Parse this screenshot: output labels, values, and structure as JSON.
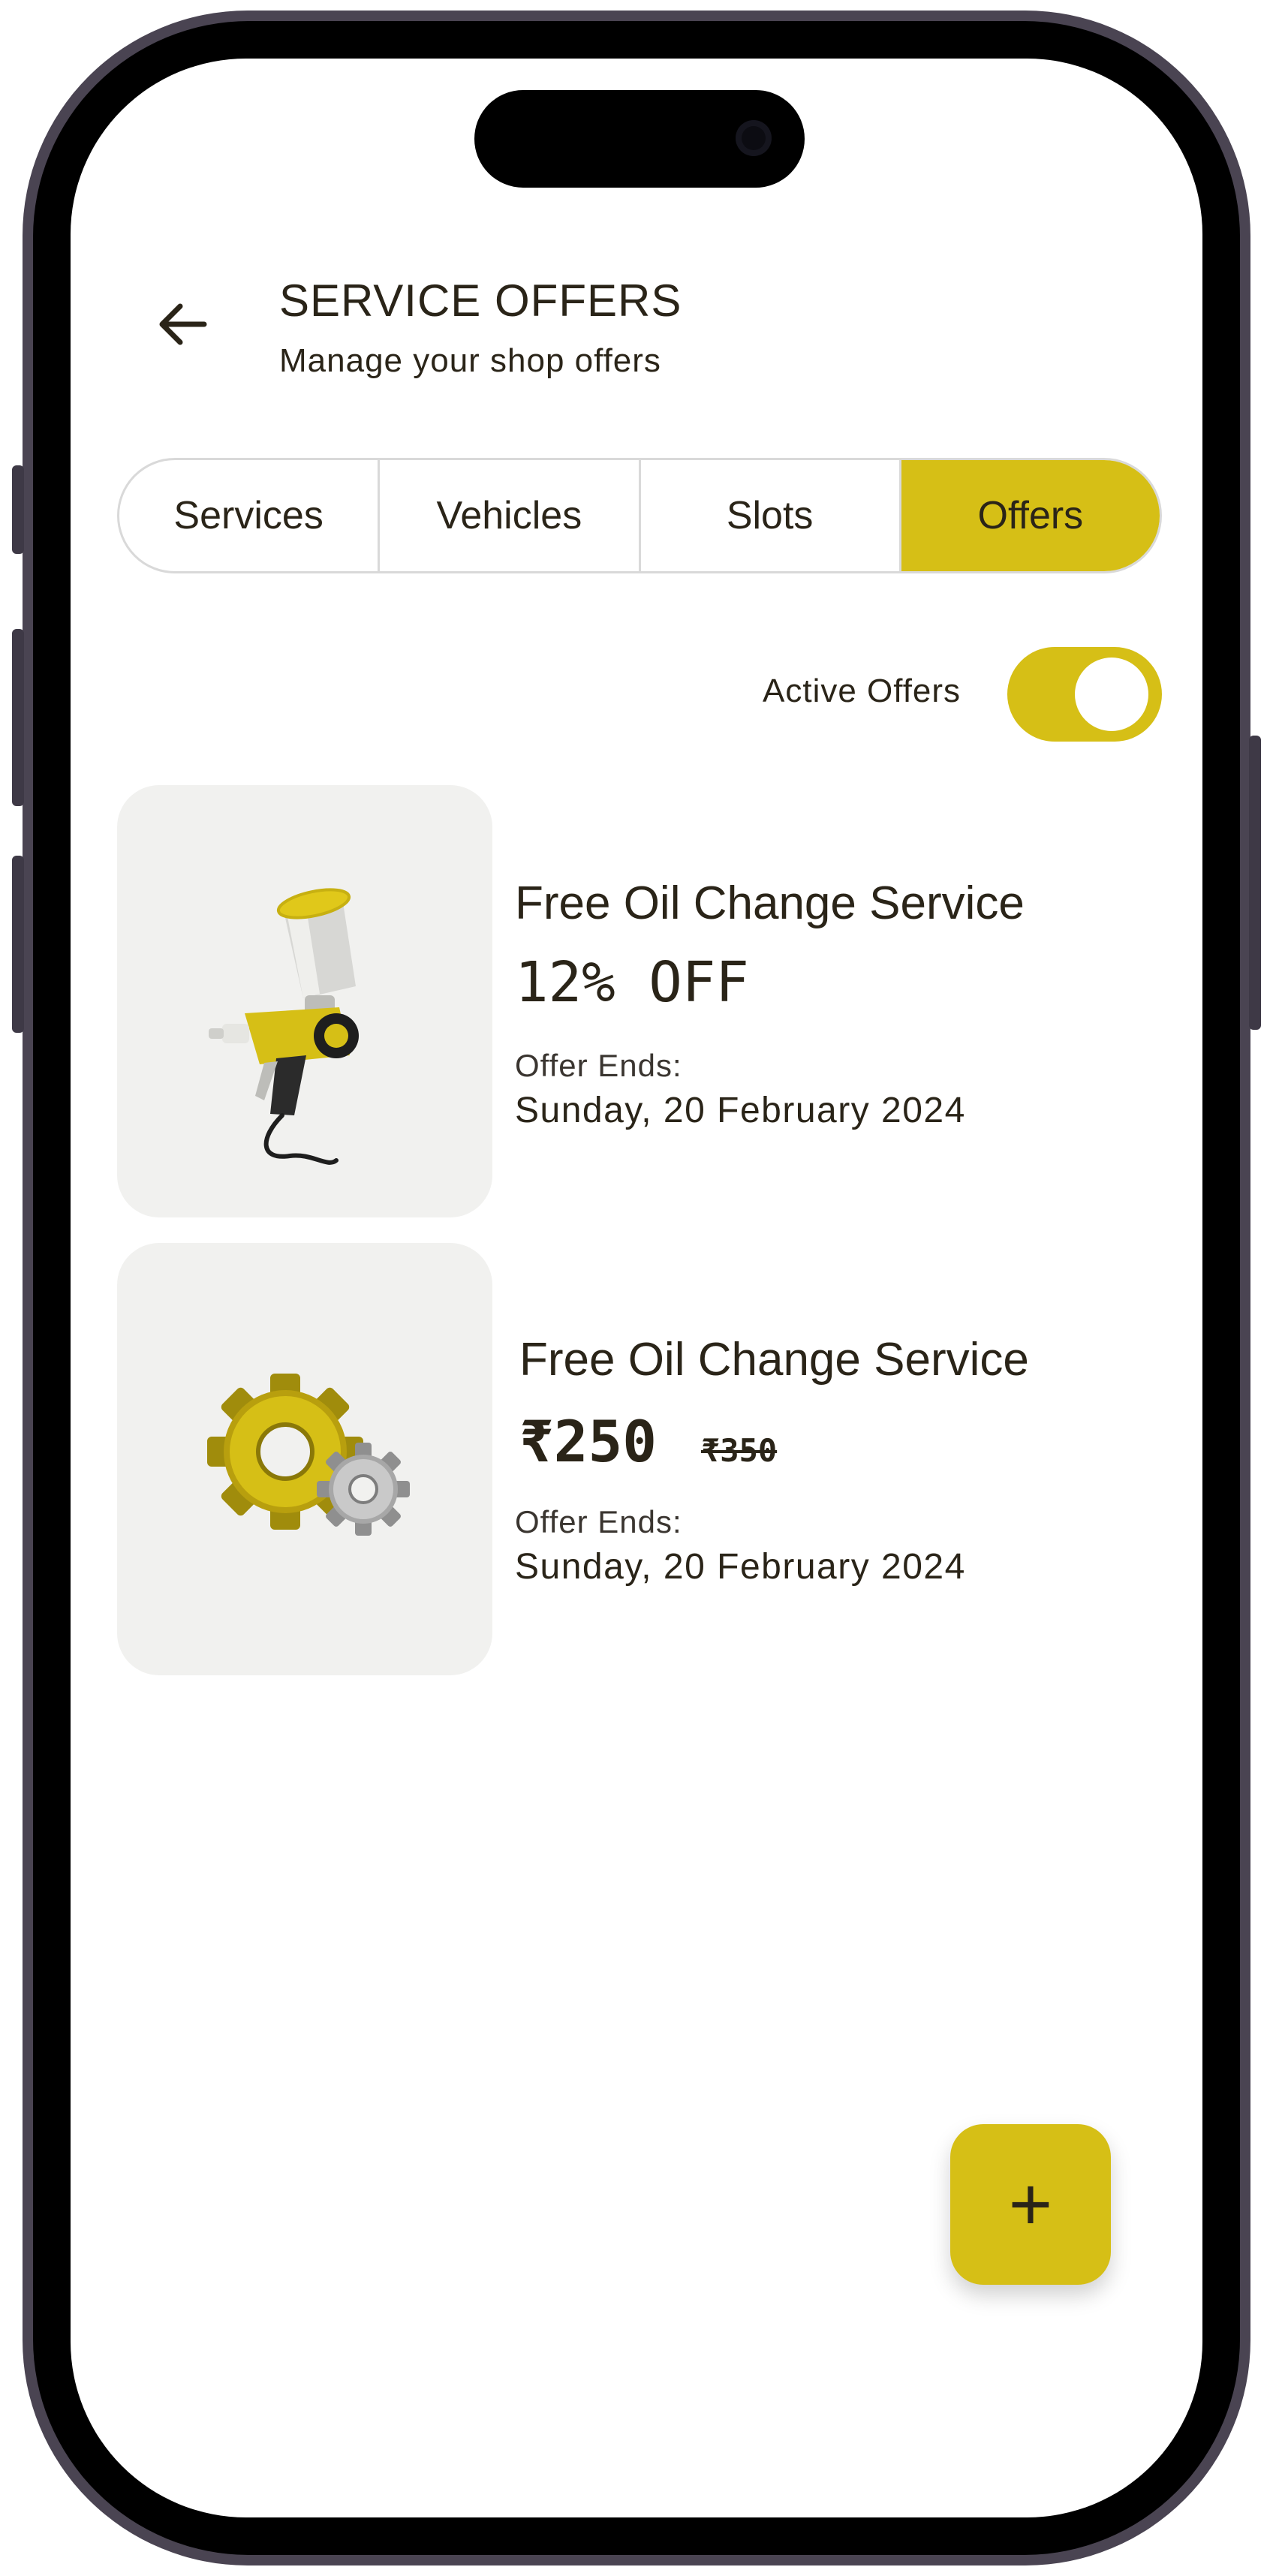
{
  "header": {
    "title": "SERVICE OFFERS",
    "subtitle": "Manage your shop offers",
    "back_icon": "arrow-left-icon"
  },
  "tabs": [
    {
      "label": "Services",
      "active": false
    },
    {
      "label": "Vehicles",
      "active": false
    },
    {
      "label": "Slots",
      "active": false
    },
    {
      "label": "Offers",
      "active": true
    }
  ],
  "filter": {
    "label": "Active Offers",
    "enabled": true
  },
  "offers": [
    {
      "title": "Free Oil Change Service",
      "discount": "12% OFF",
      "ends_label": "Offer Ends:",
      "ends_date": "Sunday, 20 February 2024",
      "icon": "spray-gun-icon"
    },
    {
      "title": "Free Oil Change Service",
      "price": "₹250",
      "old_price": "₹350",
      "ends_label": "Offer Ends:",
      "ends_date": "Sunday, 20 February 2024",
      "icon": "gears-icon"
    }
  ],
  "fab": {
    "label": "+",
    "icon": "plus-icon"
  },
  "colors": {
    "accent": "#d6bf16",
    "text": "#2a2418",
    "card_bg": "#f1f1ef",
    "border": "#d9d9d9"
  }
}
